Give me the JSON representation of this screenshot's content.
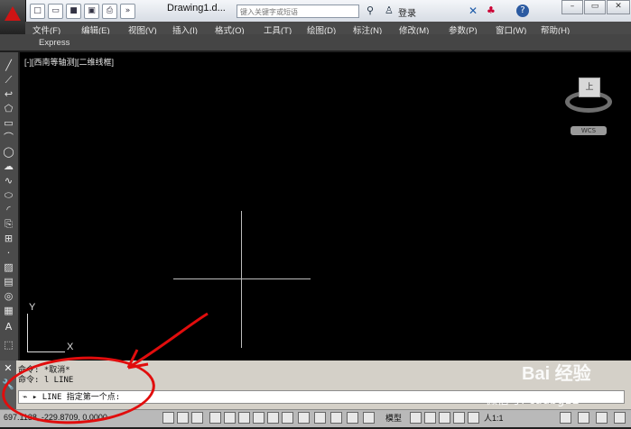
{
  "titlebar": {
    "doc_title": "Drawing1.d...",
    "search_placeholder": "键入关键字或短语",
    "login": "登录"
  },
  "menus": [
    "文件(F)",
    "编辑(E)",
    "视图(V)",
    "插入(I)",
    "格式(O)",
    "工具(T)",
    "绘图(D)",
    "标注(N)",
    "修改(M)",
    "参数(P)",
    "窗口(W)",
    "帮助(H)"
  ],
  "ribbon": {
    "express": "Express"
  },
  "canvas": {
    "viewport_label": "[-][西南等轴测][二维线框]",
    "ucs_y": "Y",
    "ucs_x": "X",
    "viewcube_face": "上",
    "wcs": "WCS"
  },
  "command": {
    "history": [
      "命令: *取消*",
      "命令: l LINE"
    ],
    "prompt": "LINE 指定第一个点:"
  },
  "status": {
    "coords": "697.1138, -229.8709, 0.0000",
    "model": "模型",
    "scale": "人1:1"
  },
  "watermark": {
    "logo": "Bai 经验",
    "account_label": "微信号: cadbg12"
  },
  "colors": {
    "annotation": "#e10d0d",
    "canvas": "#000000"
  }
}
